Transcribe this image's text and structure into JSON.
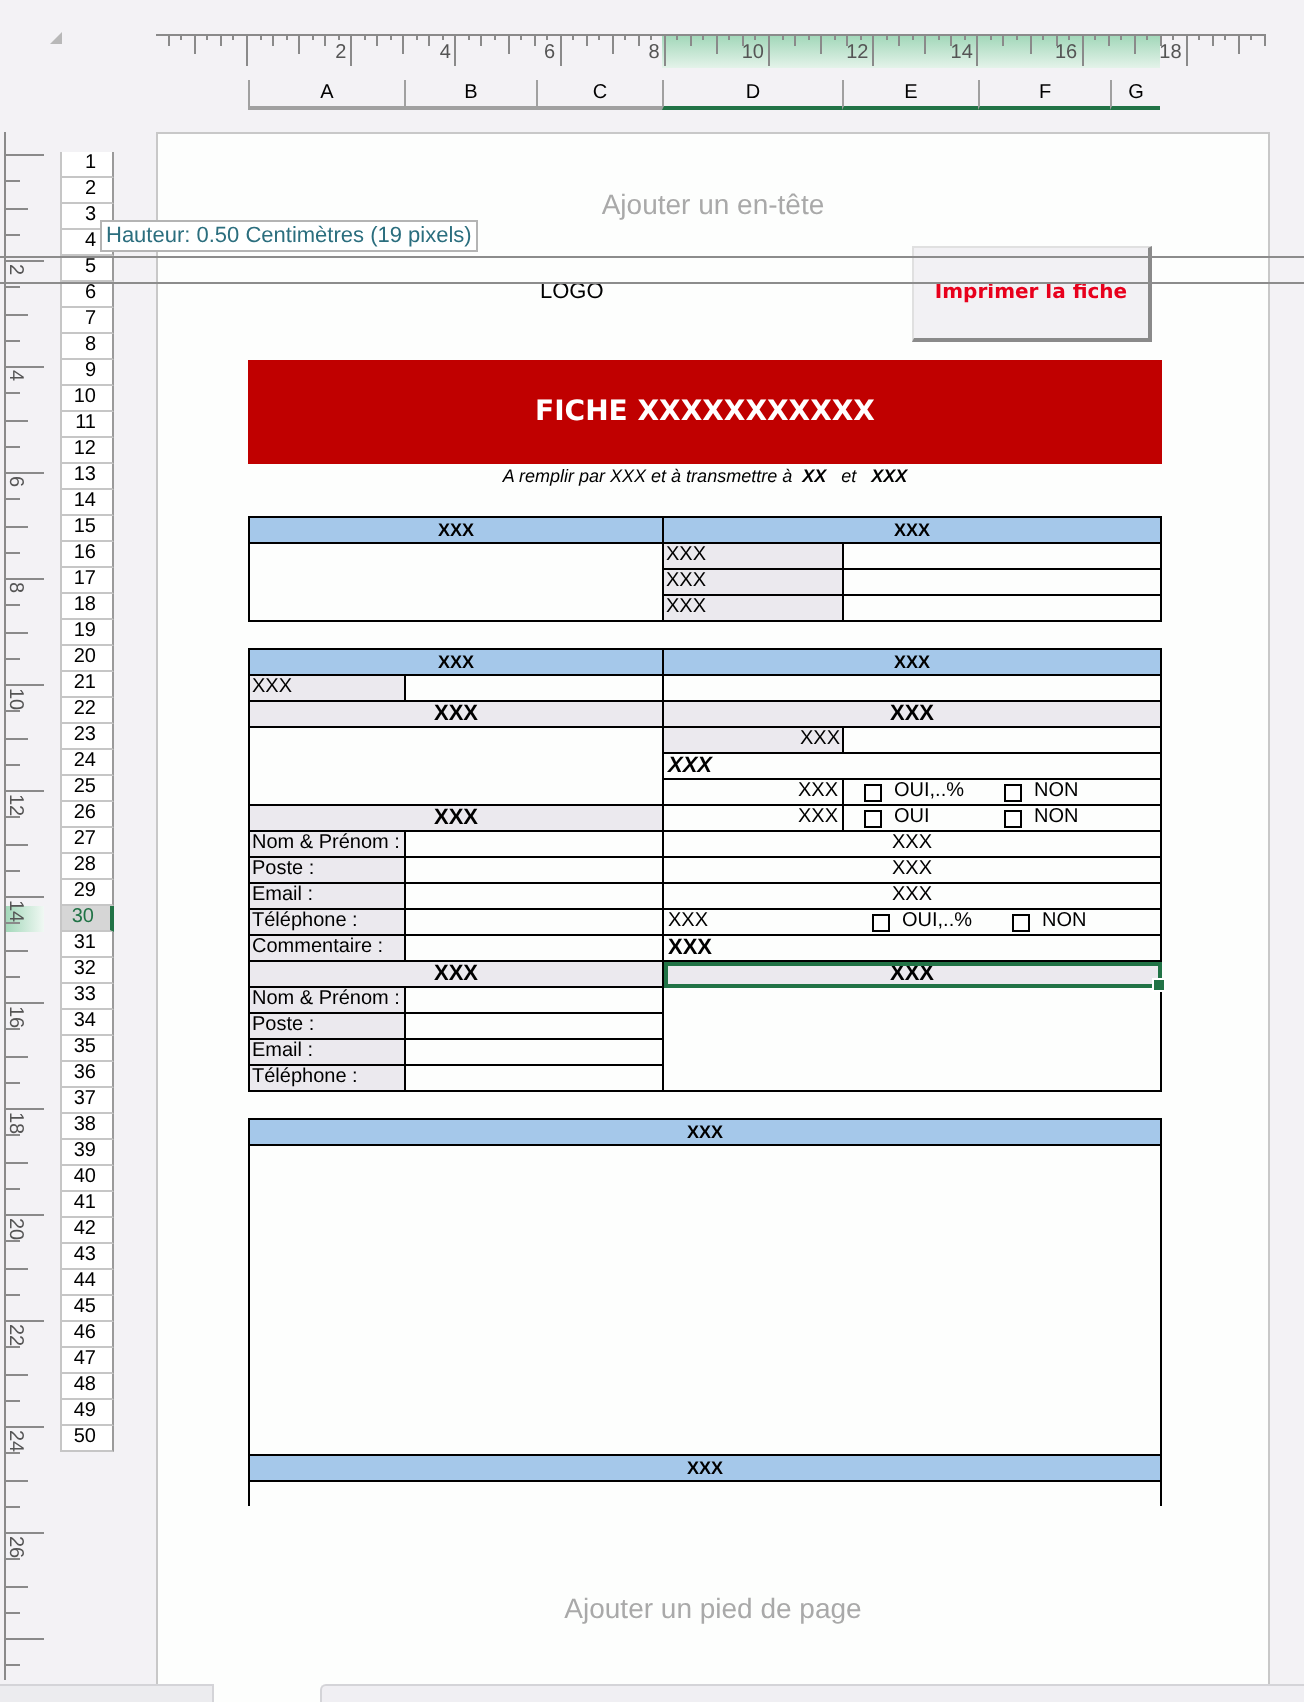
{
  "horizontal_ruler": {
    "numbers": [
      "2",
      "4",
      "6",
      "8",
      "10",
      "12",
      "14",
      "16",
      "18"
    ]
  },
  "columns": [
    {
      "label": "A",
      "selected": false
    },
    {
      "label": "B",
      "selected": false
    },
    {
      "label": "C",
      "selected": false
    },
    {
      "label": "D",
      "selected": true
    },
    {
      "label": "E",
      "selected": true
    },
    {
      "label": "F",
      "selected": true
    },
    {
      "label": "G",
      "selected": true
    }
  ],
  "vertical_ruler": {
    "numbers": [
      "2",
      "4",
      "6",
      "8",
      "10",
      "12",
      "14",
      "16",
      "18",
      "20",
      "22",
      "24",
      "26"
    ]
  },
  "row_headers": [
    {
      "label": "1",
      "selected": false
    },
    {
      "label": "2",
      "selected": false
    },
    {
      "label": "3",
      "selected": false
    },
    {
      "label": "4",
      "selected": false
    },
    {
      "label": "5",
      "selected": false
    },
    {
      "label": "6",
      "selected": false
    },
    {
      "label": "7",
      "selected": false
    },
    {
      "label": "8",
      "selected": false
    },
    {
      "label": "9",
      "selected": false
    },
    {
      "label": "10",
      "selected": false
    },
    {
      "label": "11",
      "selected": false
    },
    {
      "label": "12",
      "selected": false
    },
    {
      "label": "13",
      "selected": false
    },
    {
      "label": "14",
      "selected": false
    },
    {
      "label": "15",
      "selected": false
    },
    {
      "label": "16",
      "selected": false
    },
    {
      "label": "17",
      "selected": false
    },
    {
      "label": "18",
      "selected": false
    },
    {
      "label": "19",
      "selected": false
    },
    {
      "label": "20",
      "selected": false
    },
    {
      "label": "21",
      "selected": false
    },
    {
      "label": "22",
      "selected": false
    },
    {
      "label": "23",
      "selected": false
    },
    {
      "label": "24",
      "selected": false
    },
    {
      "label": "25",
      "selected": false
    },
    {
      "label": "26",
      "selected": false
    },
    {
      "label": "27",
      "selected": false
    },
    {
      "label": "28",
      "selected": false
    },
    {
      "label": "29",
      "selected": false
    },
    {
      "label": "30",
      "selected": true
    },
    {
      "label": "31",
      "selected": false
    },
    {
      "label": "32",
      "selected": false
    },
    {
      "label": "33",
      "selected": false
    },
    {
      "label": "34",
      "selected": false
    },
    {
      "label": "35",
      "selected": false
    },
    {
      "label": "36",
      "selected": false
    },
    {
      "label": "37",
      "selected": false
    },
    {
      "label": "38",
      "selected": false
    },
    {
      "label": "39",
      "selected": false
    },
    {
      "label": "40",
      "selected": false
    },
    {
      "label": "41",
      "selected": false
    },
    {
      "label": "42",
      "selected": false
    },
    {
      "label": "43",
      "selected": false
    },
    {
      "label": "44",
      "selected": false
    },
    {
      "label": "45",
      "selected": false
    },
    {
      "label": "46",
      "selected": false
    },
    {
      "label": "47",
      "selected": false
    },
    {
      "label": "48",
      "selected": false
    },
    {
      "label": "49",
      "selected": false
    },
    {
      "label": "50",
      "selected": false
    }
  ],
  "tooltip": "Hauteur: 0.50 Centimètres (19 pixels)",
  "page": {
    "header_placeholder": "Ajouter un en-tête",
    "logo": "LOGO",
    "print_button": "Imprimer la fiche",
    "title": "FICHE XXXXXXXXXXX",
    "subtitle": "A remplir par XXX et à transmettre à  **XX**   et   **XXX**",
    "footer_placeholder": "Ajouter un pied de page"
  },
  "info_table": {
    "headers": [
      "XXX",
      "XXX"
    ],
    "field_labels": [
      "XXX",
      "XXX",
      "XXX"
    ]
  },
  "contact_table": {
    "headers": [
      "XXX",
      "XXX"
    ],
    "left": {
      "field_label": "XXX",
      "sections": [
        "XXX",
        "XXX",
        "XXX"
      ],
      "contact_fields": [
        "Nom & Prénom :",
        "Poste :",
        "Email :",
        "Téléphone :"
      ],
      "comment_label": "Commentaire :",
      "contact_fields_2": [
        "Nom & Prénom :",
        "Poste :",
        "Email :",
        "Téléphone :"
      ]
    },
    "right": {
      "section": "XXX",
      "line_label": "XXX",
      "italic_label": "XXX",
      "questions": [
        {
          "label": "XXX",
          "options": [
            {
              "label": "OUI,..%",
              "checked": false
            },
            {
              "label": "NON",
              "checked": false
            }
          ]
        },
        {
          "label": "XXX",
          "options": [
            {
              "label": "OUI",
              "checked": false
            },
            {
              "label": "NON",
              "checked": false
            }
          ]
        }
      ],
      "values": [
        "XXX",
        "XXX",
        "XXX"
      ],
      "question_3": {
        "label": "XXX",
        "options": [
          {
            "label": "OUI,..%",
            "checked": false
          },
          {
            "label": "NON",
            "checked": false
          }
        ]
      },
      "bold_label": "XXX",
      "last_section": {
        "text": "XXX",
        "selected": true
      }
    }
  },
  "notes_table": {
    "headers": [
      "XXX",
      "XXX"
    ]
  }
}
